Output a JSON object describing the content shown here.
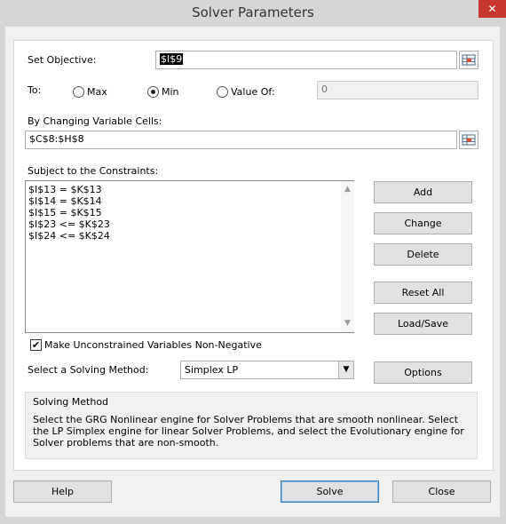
{
  "window": {
    "title": "Solver Parameters",
    "close_glyph": "✕"
  },
  "objective": {
    "label": "Set Objective:",
    "value": "$I$9"
  },
  "to": {
    "label": "To:",
    "options": [
      {
        "label": "Max",
        "selected": false
      },
      {
        "label": "Min",
        "selected": true
      },
      {
        "label": "Value Of:",
        "selected": false
      }
    ],
    "value_of": "0"
  },
  "changing": {
    "label": "By Changing Variable Cells:",
    "value": "$C$8:$H$8"
  },
  "constraints": {
    "label": "Subject to the Constraints:",
    "items": [
      "$I$13 = $K$13",
      "$I$14 = $K$14",
      "$I$15 = $K$15",
      "$I$23 <= $K$23",
      "$I$24 <= $K$24"
    ]
  },
  "buttons": {
    "add": "Add",
    "change": "Change",
    "delete": "Delete",
    "reset_all": "Reset All",
    "load_save": "Load/Save",
    "options": "Options",
    "help": "Help",
    "solve": "Solve",
    "close": "Close"
  },
  "nonnegative": {
    "label": "Make Unconstrained Variables Non-Negative",
    "checked": true,
    "glyph": "✔"
  },
  "method": {
    "label": "Select a Solving Method:",
    "value": "Simplex LP",
    "group_title": "Solving Method",
    "description": "Select the GRG Nonlinear engine for Solver Problems that are smooth nonlinear. Select the LP Simplex engine for linear Solver Problems, and select the Evolutionary engine for Solver problems that are non-smooth."
  },
  "icons": {
    "ref_button": "range-select-icon",
    "scroll_up": "▲",
    "scroll_down": "▼",
    "dropdown": "▼"
  },
  "colors": {
    "close": "#c7372f",
    "default_border": "#3c7fb1"
  }
}
